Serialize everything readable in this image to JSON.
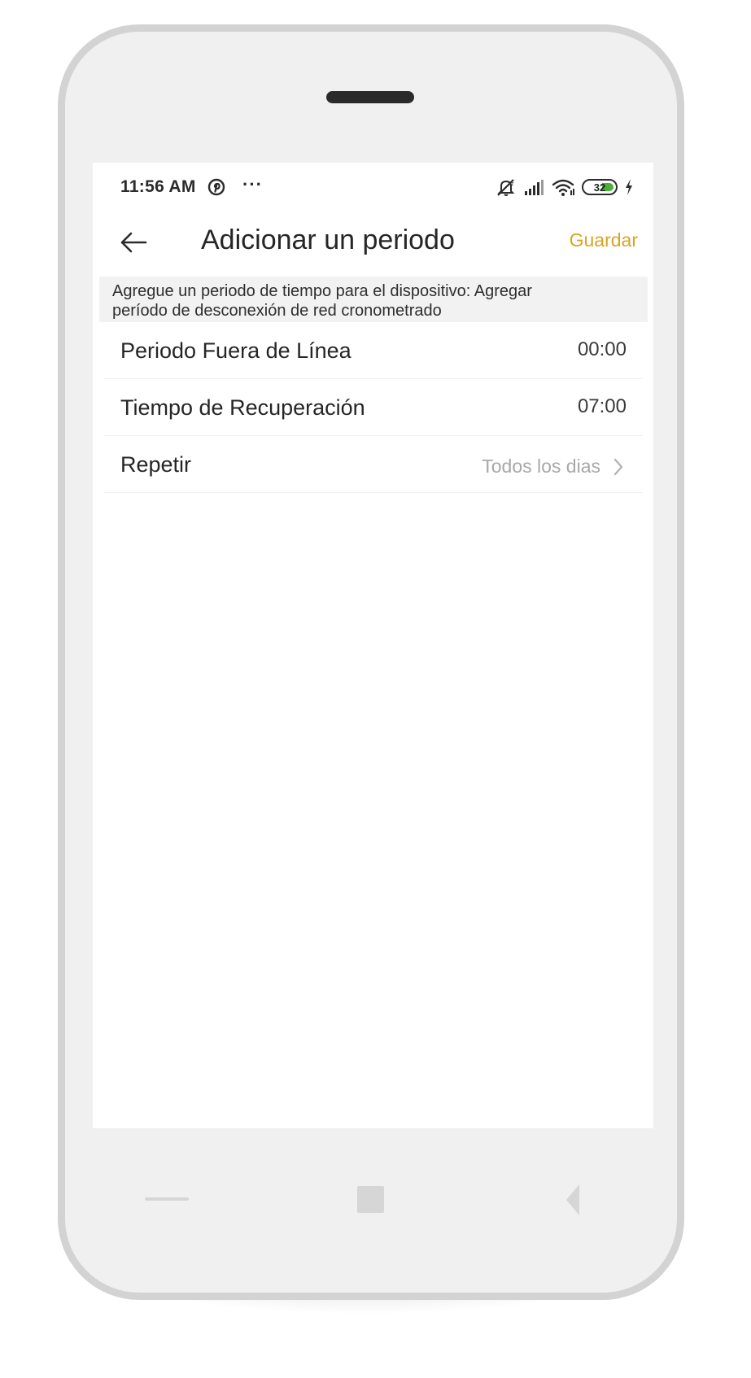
{
  "status_bar": {
    "time": "11:56 AM",
    "more": "···",
    "battery_level": "32",
    "icons": [
      "pinterest-icon",
      "notifications-off-icon",
      "signal-icon",
      "wifi-icon",
      "battery-icon",
      "charging-icon"
    ],
    "battery_color": "#4caf3a"
  },
  "header": {
    "back_icon": "arrow-left-icon",
    "title": "Adicionar un periodo",
    "save_label": "Guardar",
    "accent_color": "#d9a521"
  },
  "info_banner": {
    "line1": "Agregue un periodo de tiempo para el dispositivo:  Agregar",
    "line2": "período de desconexión de red cronometrado"
  },
  "rows": [
    {
      "label": "Periodo Fuera de Línea",
      "value": "00:00"
    },
    {
      "label": "Tiempo de Recuperación",
      "value": "07:00"
    },
    {
      "label": "Repetir",
      "value": "Todos los dias"
    }
  ],
  "nav_bar": {
    "icons": [
      "menu-icon",
      "home-icon",
      "back-triangle-icon"
    ]
  }
}
